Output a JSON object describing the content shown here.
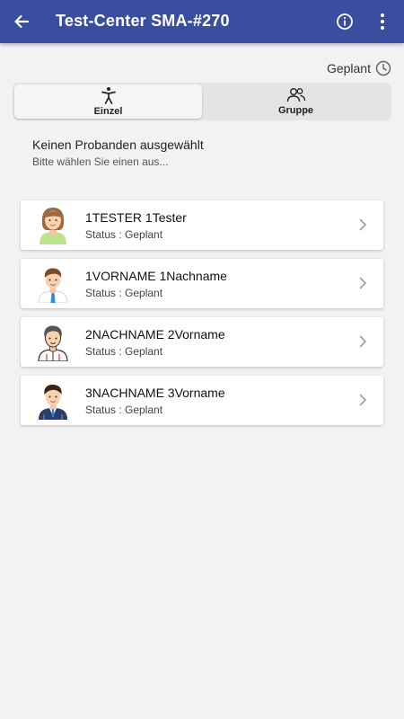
{
  "appbar": {
    "title": "Test-Center SMA-#270",
    "back_icon": "arrow-left-icon",
    "info_icon": "info-icon",
    "more_icon": "more-vert-icon",
    "color": "#3a4ea0"
  },
  "status_filter": {
    "label": "Geplant",
    "icon": "clock-icon"
  },
  "segments": [
    {
      "label": "Einzel",
      "icon": "person-accessibility-icon",
      "active": true
    },
    {
      "label": "Gruppe",
      "icon": "group-icon",
      "active": false
    }
  ],
  "empty_selection": {
    "title": "Keinen Probanden ausgewählt",
    "subtitle": "Bitte wählen Sie einen aus..."
  },
  "subjects": [
    {
      "name": "1TESTER 1Tester",
      "status": "Status : Geplant",
      "avatar": "female-avatar-icon"
    },
    {
      "name": "1VORNAME 1Nachname",
      "status": "Status : Geplant",
      "avatar": "male-avatar-tie-icon"
    },
    {
      "name": "2NACHNAME 2Vorname",
      "status": "Status : Geplant",
      "avatar": "male-avatar-shirt-icon"
    },
    {
      "name": "3NACHNAME 3Vorname",
      "status": "Status : Geplant",
      "avatar": "male-avatar-suit-icon"
    }
  ]
}
